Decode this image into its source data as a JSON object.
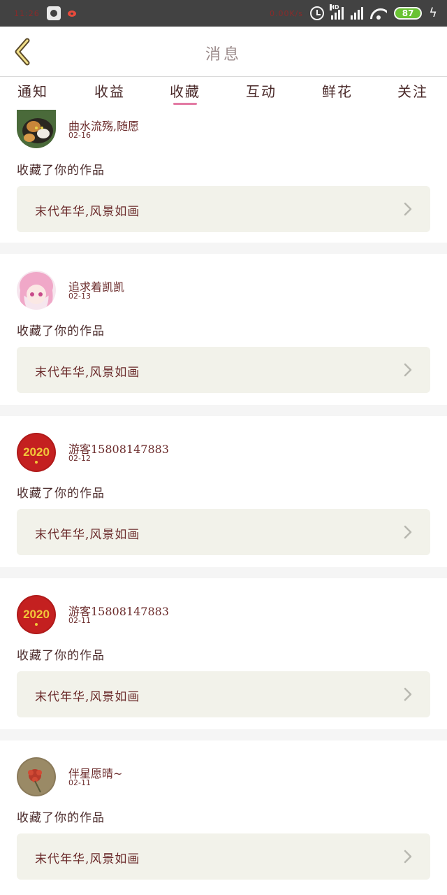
{
  "status_bar": {
    "time_text": "11:26",
    "speed_text": "0.00K/s",
    "signal_label": "HD",
    "battery_level": "87"
  },
  "header": {
    "title": "消息",
    "back_icon": "chevron-left-icon"
  },
  "tabs": [
    {
      "label": "通知",
      "active": false
    },
    {
      "label": "收益",
      "active": false
    },
    {
      "label": "收藏",
      "active": true
    },
    {
      "label": "互动",
      "active": false
    },
    {
      "label": "鲜花",
      "active": false
    },
    {
      "label": "关注",
      "active": false
    }
  ],
  "accent_color": "#e37aa3",
  "items": [
    {
      "username": "曲水流殇,随愿",
      "date": "02-16",
      "action": "收藏了你的作品",
      "work_title": "末代年华,风景如画",
      "avatar": "cat-avatar"
    },
    {
      "username": "追求着凯凯",
      "date": "02-13",
      "action": "收藏了你的作品",
      "work_title": "末代年华,风景如画",
      "avatar": "anime-girl-avatar"
    },
    {
      "username": "游客15808147883",
      "date": "02-12",
      "action": "收藏了你的作品",
      "work_title": "末代年华,风景如画",
      "avatar": "2020-avatar"
    },
    {
      "username": "游客15808147883",
      "date": "02-11",
      "action": "收藏了你的作品",
      "work_title": "末代年华,风景如画",
      "avatar": "2020-avatar"
    },
    {
      "username": "伴星愿晴~",
      "date": "02-11",
      "action": "收藏了你的作品",
      "work_title": "末代年华,风景如画",
      "avatar": "flower-avatar"
    }
  ]
}
